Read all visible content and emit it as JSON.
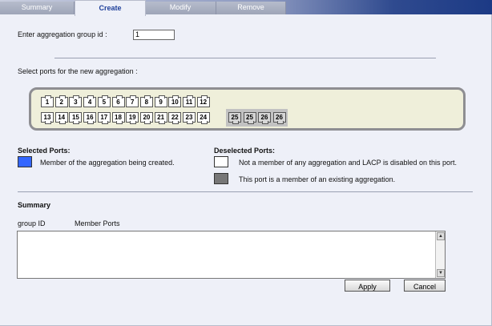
{
  "tabs": [
    {
      "label": "Summary"
    },
    {
      "label": "Create"
    },
    {
      "label": "Modify"
    },
    {
      "label": "Remove"
    }
  ],
  "group_id": {
    "label": "Enter aggregation group id :",
    "value": "1"
  },
  "select_ports": {
    "label": "Select ports for the new aggregation :"
  },
  "ports_top": [
    "1",
    "2",
    "3",
    "4",
    "5",
    "6",
    "7",
    "8",
    "9",
    "10",
    "11",
    "12"
  ],
  "ports_bottom": [
    "13",
    "14",
    "15",
    "16",
    "17",
    "18",
    "19",
    "20",
    "21",
    "22",
    "23",
    "24"
  ],
  "ports_member": [
    "25",
    "25",
    "26",
    "26"
  ],
  "legend": {
    "selected_title": "Selected Ports:",
    "selected_desc": "Member of the aggregation being created.",
    "deselected_title": "Deselected Ports:",
    "not_member_desc": "Not a member of any aggregation and LACP is disabled on this port.",
    "existing_desc": "This port is a member of an existing aggregation.",
    "colors": {
      "selected": "#3366ff",
      "not_member": "#ffffff",
      "existing": "#777777"
    }
  },
  "summary": {
    "title": "Summary",
    "col_group": "group ID",
    "col_members": "Member Ports"
  },
  "buttons": {
    "apply": "Apply",
    "cancel": "Cancel"
  }
}
